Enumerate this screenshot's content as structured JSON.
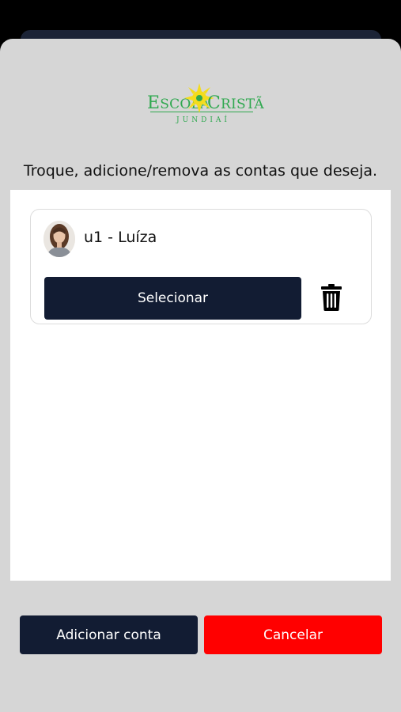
{
  "logo": {
    "word_left": "Escola",
    "word_right": "Cristã",
    "subtitle": "JUNDIAÍ",
    "colors": {
      "text": "#2fa84f",
      "flower": "#f4dc1c"
    }
  },
  "instruction": "Troque, adicione/remova as contas que deseja.",
  "accounts": [
    {
      "name": "u1 - Luíza",
      "select_label": "Selecionar",
      "delete_icon": "trash-icon"
    }
  ],
  "footer": {
    "add_label": "Adicionar conta",
    "cancel_label": "Cancelar"
  },
  "colors": {
    "primary": "#121c33",
    "danger": "#ff0000",
    "sheet": "#d6d6d6"
  }
}
